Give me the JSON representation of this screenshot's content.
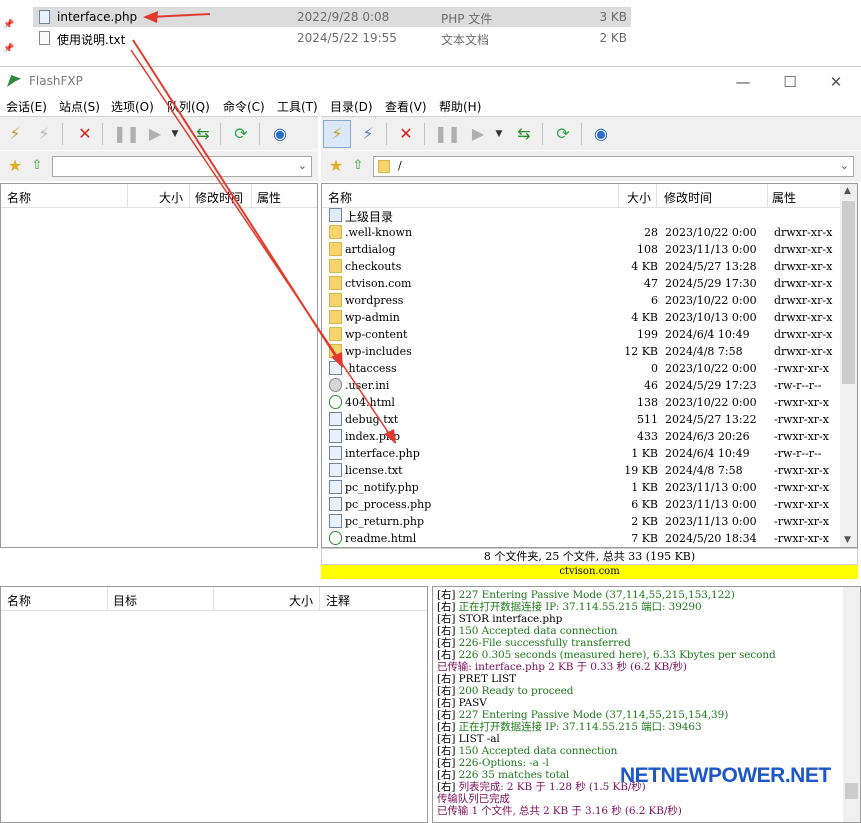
{
  "explorer": {
    "files": [
      {
        "name": "interface.php",
        "date": "2022/9/28 0:08",
        "type": "PHP 文件",
        "size": "3 KB",
        "selected": true
      },
      {
        "name": "使用说明.txt",
        "date": "2024/5/22 19:55",
        "type": "文本文档",
        "size": "2 KB",
        "selected": false
      }
    ]
  },
  "window": {
    "title": "FlashFXP",
    "minimize": "—",
    "maximize": "☐",
    "close": "✕"
  },
  "menu": [
    "会话(E)",
    "站点(S)",
    "选项(O)",
    "队列(Q)",
    "命令(C)",
    "工具(T)",
    "目录(D)",
    "查看(V)",
    "帮助(H)"
  ],
  "left_pane": {
    "path": "",
    "columns": [
      "名称",
      "大小",
      "修改时间",
      "属性"
    ]
  },
  "right_pane": {
    "path": "/",
    "columns": [
      "名称",
      "大小",
      "修改时间",
      "属性"
    ],
    "parent_label": "上级目录",
    "files": [
      {
        "icon": "folder",
        "name": ".well-known",
        "size": "28",
        "date": "2023/10/22 0:00",
        "attr": "drwxr-xr-x"
      },
      {
        "icon": "folder",
        "name": "artdialog",
        "size": "108",
        "date": "2023/11/13 0:00",
        "attr": "drwxr-xr-x"
      },
      {
        "icon": "folder",
        "name": "checkouts",
        "size": "4 KB",
        "date": "2024/5/27 13:28",
        "attr": "drwxr-xr-x"
      },
      {
        "icon": "folder",
        "name": "ctvison.com",
        "size": "47",
        "date": "2024/5/29 17:30",
        "attr": "drwxr-xr-x"
      },
      {
        "icon": "folder",
        "name": "wordpress",
        "size": "6",
        "date": "2023/10/22 0:00",
        "attr": "drwxr-xr-x"
      },
      {
        "icon": "folder",
        "name": "wp-admin",
        "size": "4 KB",
        "date": "2023/10/13 0:00",
        "attr": "drwxr-xr-x"
      },
      {
        "icon": "folder",
        "name": "wp-content",
        "size": "199",
        "date": "2024/6/4 10:49",
        "attr": "drwxr-xr-x"
      },
      {
        "icon": "folder",
        "name": "wp-includes",
        "size": "12 KB",
        "date": "2024/4/8 7:58",
        "attr": "drwxr-xr-x"
      },
      {
        "icon": "file",
        "name": ".htaccess",
        "size": "0",
        "date": "2023/10/22 0:00",
        "attr": "-rwxr-xr-x"
      },
      {
        "icon": "gear",
        "name": ".user.ini",
        "size": "46",
        "date": "2024/5/29 17:23",
        "attr": "-rw-r--r--"
      },
      {
        "icon": "html",
        "name": "404.html",
        "size": "138",
        "date": "2023/10/22 0:00",
        "attr": "-rwxr-xr-x"
      },
      {
        "icon": "file",
        "name": "debug.txt",
        "size": "511",
        "date": "2024/5/27 13:22",
        "attr": "-rwxr-xr-x"
      },
      {
        "icon": "file",
        "name": "index.php",
        "size": "433",
        "date": "2024/6/3 20:26",
        "attr": "-rwxr-xr-x"
      },
      {
        "icon": "file",
        "name": "interface.php",
        "size": "1 KB",
        "date": "2024/6/4 10:49",
        "attr": "-rw-r--r--"
      },
      {
        "icon": "file",
        "name": "license.txt",
        "size": "19 KB",
        "date": "2024/4/8 7:58",
        "attr": "-rwxr-xr-x"
      },
      {
        "icon": "file",
        "name": "pc_notify.php",
        "size": "1 KB",
        "date": "2023/11/13 0:00",
        "attr": "-rwxr-xr-x"
      },
      {
        "icon": "file",
        "name": "pc_process.php",
        "size": "6 KB",
        "date": "2023/11/13 0:00",
        "attr": "-rwxr-xr-x"
      },
      {
        "icon": "file",
        "name": "pc_return.php",
        "size": "2 KB",
        "date": "2023/11/13 0:00",
        "attr": "-rwxr-xr-x"
      },
      {
        "icon": "html",
        "name": "readme.html",
        "size": "7 KB",
        "date": "2024/5/20 18:34",
        "attr": "-rwxr-xr-x"
      }
    ],
    "status": "8 个文件夹, 25 个文件, 总共 33 (195 KB)",
    "site": "ctvison.com"
  },
  "queue": {
    "columns": [
      "名称",
      "目标",
      "大小",
      "注释"
    ]
  },
  "log": [
    {
      "color": "g",
      "tag": "[右]",
      "text": " 227 Entering Passive Mode (37,114,55,215,153,122)"
    },
    {
      "color": "g",
      "tag": "[右]",
      "text": " 正在打开数据连接 IP: 37.114.55.215 端口: 39290"
    },
    {
      "color": "b",
      "tag": "[右]",
      "text": " STOR interface.php"
    },
    {
      "color": "g",
      "tag": "[右]",
      "text": " 150 Accepted data connection"
    },
    {
      "color": "g",
      "tag": "[右]",
      "text": " 226-File successfully transferred"
    },
    {
      "color": "g",
      "tag": "[右]",
      "text": " 226 0.305 seconds (measured here), 6.33 Kbytes per second"
    },
    {
      "color": "p",
      "tag": "",
      "text": "已传输: interface.php 2 KB 于 0.33 秒 (6.2 KB/秒)"
    },
    {
      "color": "b",
      "tag": "[右]",
      "text": " PRET LIST"
    },
    {
      "color": "g",
      "tag": "[右]",
      "text": " 200 Ready to proceed"
    },
    {
      "color": "b",
      "tag": "[右]",
      "text": " PASV"
    },
    {
      "color": "g",
      "tag": "[右]",
      "text": " 227 Entering Passive Mode (37,114,55,215,154,39)"
    },
    {
      "color": "g",
      "tag": "[右]",
      "text": " 正在打开数据连接 IP: 37.114.55.215 端口: 39463"
    },
    {
      "color": "b",
      "tag": "[右]",
      "text": " LIST -al"
    },
    {
      "color": "g",
      "tag": "[右]",
      "text": " 150 Accepted data connection"
    },
    {
      "color": "g",
      "tag": "[右]",
      "text": " 226-Options: -a -l"
    },
    {
      "color": "g",
      "tag": "[右]",
      "text": " 226 35 matches total"
    },
    {
      "color": "p",
      "tag": "[右]",
      "text": " 列表完成: 2 KB 于 1.28 秒 (1.5 KB/秒)"
    },
    {
      "color": "p",
      "tag": "",
      "text": "传输队列已完成"
    },
    {
      "color": "p",
      "tag": "",
      "text": "已传输 1 个文件, 总共 2 KB 于 3.16 秒 (6.2 KB/秒)"
    }
  ],
  "watermark": "NETNEWPOWER.NET"
}
